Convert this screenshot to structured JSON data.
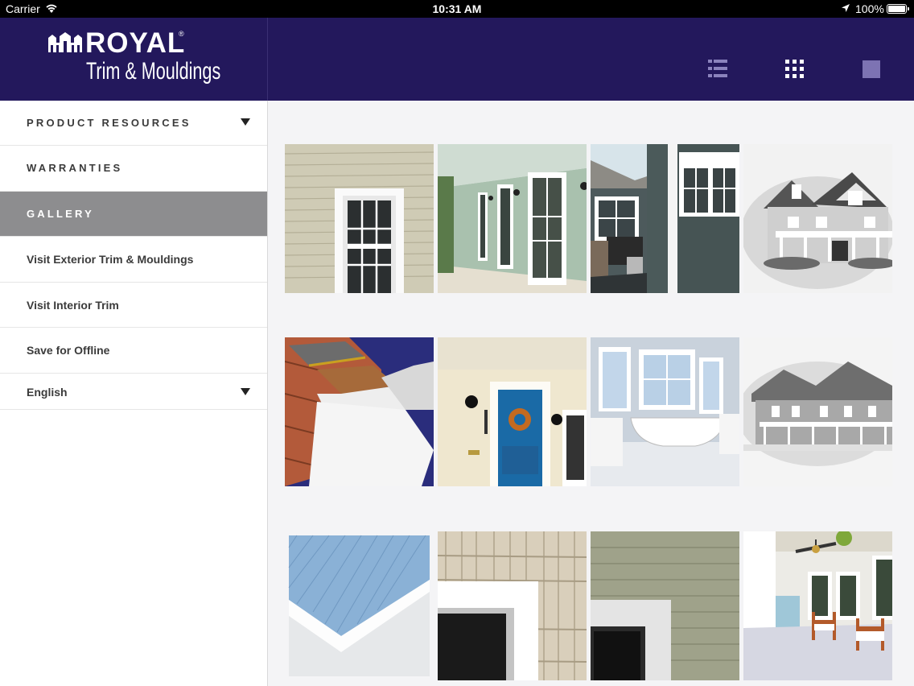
{
  "status_bar": {
    "carrier": "Carrier",
    "time": "10:31 AM",
    "battery": "100%"
  },
  "brand": {
    "name": "ROYAL",
    "registered": "®",
    "tagline": "Trim & Mouldings",
    "header_color": "#23185c"
  },
  "view_toggles": [
    "list-view",
    "grid-view",
    "single-view"
  ],
  "sidebar": {
    "items": [
      {
        "label": "PRODUCT RESOURCES",
        "has_dropdown": true
      },
      {
        "label": "WARRANTIES"
      },
      {
        "label": "GALLERY",
        "active": true
      },
      {
        "label": "Visit Exterior Trim & Mouldings"
      },
      {
        "label": "Visit Interior Trim"
      },
      {
        "label": "Save for Offline"
      },
      {
        "label": "English",
        "has_dropdown": true
      }
    ]
  },
  "gallery": {
    "images": [
      "siding-window-photo",
      "porch-windows-photo",
      "house-corner-grill-photo",
      "house-rendering-photo",
      "trim-cutaway-photo",
      "blue-front-door-photo",
      "bathroom-tub-photo",
      "large-house-rendering-photo",
      "soffit-closeup-photo",
      "shake-siding-window-photo",
      "green-siding-window-photo",
      "porch-chairs-photo"
    ]
  }
}
